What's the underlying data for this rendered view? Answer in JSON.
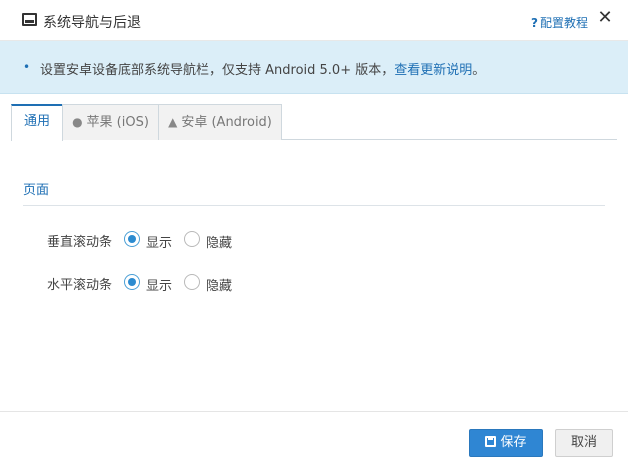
{
  "header": {
    "title": "系统导航与后退",
    "help_label": "配置教程",
    "help_mark": "?",
    "close_glyph": "✕"
  },
  "notice": {
    "bullet": "•",
    "text": "设置安卓设备底部系统导航栏，仅支持 Android 5.0+ 版本，",
    "link": "查看更新说明",
    "suffix": "。"
  },
  "tabs": [
    {
      "label": "通用"
    },
    {
      "label": "苹果 (iOS)",
      "icon": "apple-icon"
    },
    {
      "label": "安卓 (Android)",
      "icon": "android-icon"
    }
  ],
  "section": {
    "title": "页面"
  },
  "settings": [
    {
      "label": "垂直滚动条",
      "options": [
        "显示",
        "隐藏"
      ],
      "selected": "显示"
    },
    {
      "label": "水平滚动条",
      "options": [
        "显示",
        "隐藏"
      ],
      "selected": "显示"
    }
  ],
  "footer": {
    "save_label": "保存",
    "cancel_label": "取消"
  },
  "colors": {
    "accent": "#1e6fb4",
    "notice_bg": "#dbeef8",
    "primary_button": "#2f86d3"
  }
}
